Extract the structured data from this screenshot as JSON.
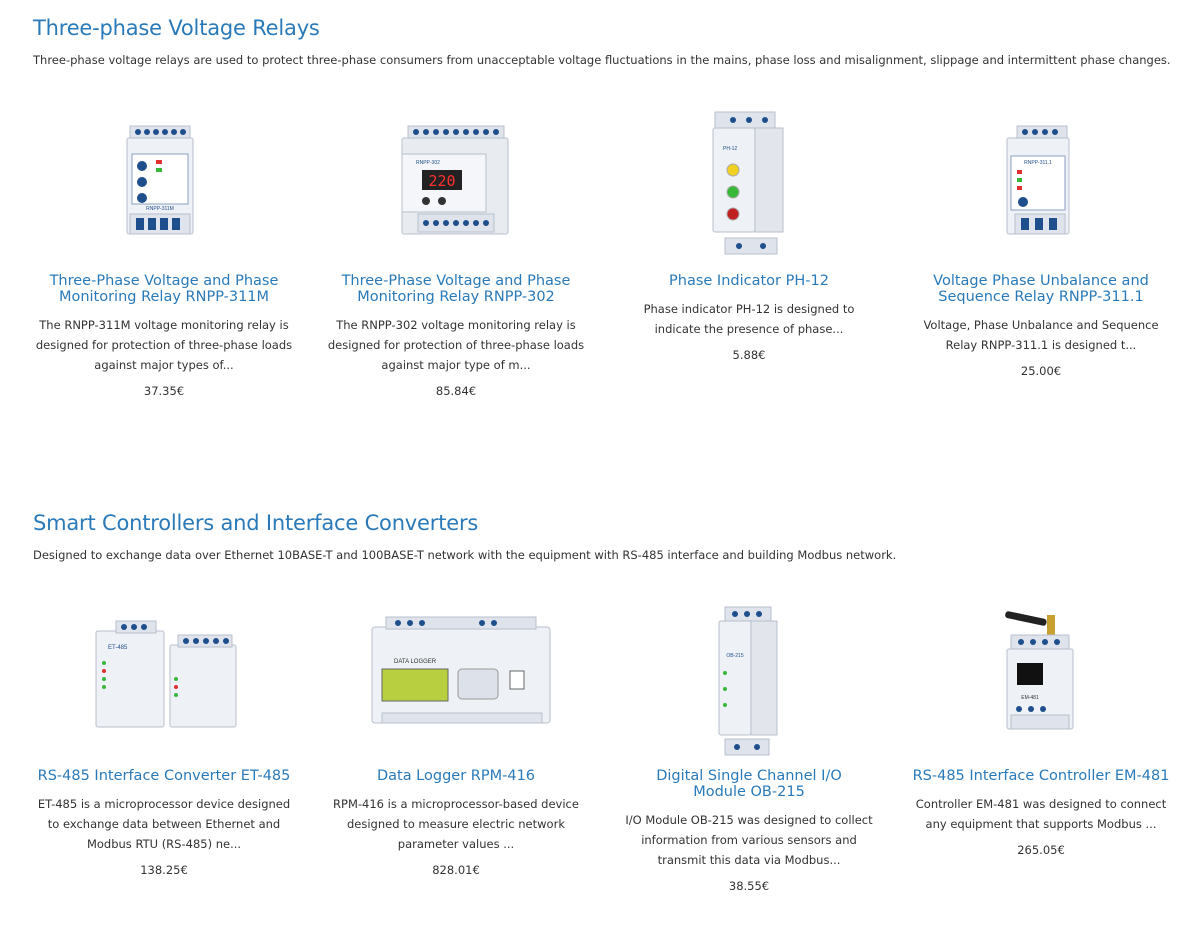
{
  "sections": [
    {
      "title": "Three-phase Voltage Relays",
      "description": "Three-phase voltage relays are used to protect three-phase consumers from unacceptable voltage fluctuations in the mains, phase loss and misalignment, slippage and intermittent phase changes.",
      "products": [
        {
          "title": "Three-Phase Voltage and Phase Monitoring Relay RNPP-311M",
          "description": "The RNPP-311M voltage monitoring relay is designed for protection of three-phase loads against major types of...",
          "price": "37.35€",
          "image_label": "RNPP-311M"
        },
        {
          "title": "Three-Phase Voltage and Phase Monitoring Relay RNPP-302",
          "description": "The RNPP-302 voltage monitoring relay is designed for protection of three-phase loads against major type of m...",
          "price": "85.84€",
          "image_label": "RNPP-302",
          "display": "220"
        },
        {
          "title": "Phase Indicator PH-12",
          "description": "Phase indicator PH-12 is designed to indicate the presence of phase...",
          "price": "5.88€",
          "image_label": "PH-12"
        },
        {
          "title": "Voltage Phase Unbalance and Sequence Relay RNPP-311.1",
          "description": "Voltage, Phase Unbalance and  Sequence Relay RNPP-311.1 is designed t...",
          "price": "25.00€",
          "image_label": "RNPP-311.1"
        }
      ]
    },
    {
      "title": "Smart Controllers and Interface Converters",
      "description": "Designed to exchange data over Ethernet 10BASE-T and 100BASE-T network with the equipment with RS-485 interface and building Modbus network.",
      "products": [
        {
          "title": "RS-485 Interface Converter ET-485",
          "description": "ET-485 is a microprocessor device designed to exchange data between Ethernet and Modbus RTU (RS-485) ne...",
          "price": "138.25€",
          "image_label": "ET-485"
        },
        {
          "title": "Data Logger RPM-416",
          "description": "RPM-416 is a microprocessor-based device designed to measure electric network parameter values ...",
          "price": "828.01€",
          "image_label": "DATA LOGGER"
        },
        {
          "title": "Digital Single Channel I/O Module OB-215",
          "description": "I/O Module OB-215 was designed to collect information from various sensors and transmit this data via Modbus...",
          "price": "38.55€",
          "image_label": "OB-215"
        },
        {
          "title": "RS-485 Interface Controller EM-481",
          "description": "Controller EM-481 was designed to connect any equipment that supports Modbus ...",
          "price": "265.05€",
          "image_label": "EM-481"
        }
      ]
    }
  ],
  "colors": {
    "link": "#2a7ab9",
    "text": "#333333",
    "device_body": "#e4e8ef",
    "terminal": "#1f4e8c"
  }
}
